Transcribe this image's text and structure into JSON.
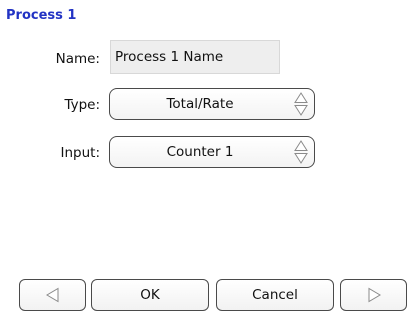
{
  "dialog": {
    "title": "Process 1"
  },
  "fields": {
    "name": {
      "label": "Name:",
      "value": "Process 1 Name"
    },
    "type": {
      "label": "Type:",
      "value": "Total/Rate",
      "icon": "up-down-arrows-icon"
    },
    "input": {
      "label": "Input:",
      "value": "Counter 1",
      "icon": "up-down-arrows-icon"
    }
  },
  "buttons": {
    "previous_icon": "left-triangle-icon",
    "ok": "OK",
    "cancel": "Cancel",
    "next_icon": "right-triangle-icon"
  },
  "colors": {
    "title": "#2233c4",
    "name_field_background": "#eeeeee",
    "border": "#4a4a4a",
    "arrow_outline": "#8a8a8a"
  }
}
